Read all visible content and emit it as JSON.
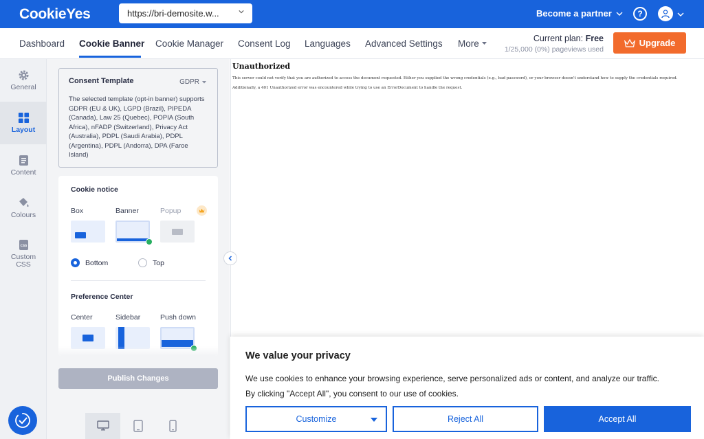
{
  "app": {
    "logo": "CookieYes",
    "site_url": "https://bri-demosite.w...",
    "become_partner": "Become a partner"
  },
  "nav": {
    "items": [
      "Dashboard",
      "Cookie Banner",
      "Cookie Manager",
      "Consent Log",
      "Languages",
      "Advanced Settings",
      "More"
    ],
    "active": "Cookie Banner",
    "plan_label": "Current plan:",
    "plan_name": "Free",
    "pageviews": "1/25,000 (0%) pageviews used",
    "upgrade": "Upgrade"
  },
  "sidebar": {
    "items": [
      {
        "label": "General",
        "icon": "gear-icon"
      },
      {
        "label": "Layout",
        "icon": "layout-icon",
        "active": true
      },
      {
        "label": "Content",
        "icon": "document-icon"
      },
      {
        "label": "Colours",
        "icon": "paint-bucket-icon"
      },
      {
        "label": "Custom CSS",
        "icon": "css-file-icon"
      }
    ]
  },
  "template": {
    "title": "Consent Template",
    "law": "GDPR",
    "description": "The selected template (opt-in banner) supports GDPR (EU & UK), LGPD (Brazil), PIPEDA (Canada), Law 25 (Quebec), POPIA (South Africa), nFADP (Switzerland), Privacy Act (Australia), PDPL (Saudi Arabia), PDPL (Argentina), PDPL (Andorra), DPA (Faroe Island)"
  },
  "cookie_notice": {
    "heading": "Cookie notice",
    "options": [
      "Box",
      "Banner",
      "Popup"
    ],
    "selected": "Banner",
    "positions": [
      "Bottom",
      "Top"
    ],
    "position_selected": "Bottom"
  },
  "preference_center": {
    "heading": "Preference Center",
    "options": [
      "Center",
      "Sidebar",
      "Push down"
    ],
    "selected": "Push down"
  },
  "publish": "Publish Changes",
  "preview": {
    "error_title": "Unauthorized",
    "error_line1": "This server could not verify that you are authorized to access the document requested. Either you supplied the wrong credentials (e.g., bad password), or your browser doesn't understand how to supply the credentials required.",
    "error_line2": "Additionally, a 401 Unauthorized error was encountered while trying to use an ErrorDocument to handle the request."
  },
  "banner": {
    "title": "We value your privacy",
    "text_line1": "We use cookies to enhance your browsing experience, serve personalized ads or content, and analyze our traffic.",
    "text_line2": "By clicking \"Accept All\", you consent to our use of cookies.",
    "customize": "Customize",
    "reject": "Reject All",
    "accept": "Accept All"
  },
  "colors": {
    "brand": "#1863dc",
    "upgrade": "#f26b2c",
    "success": "#27ae60"
  }
}
